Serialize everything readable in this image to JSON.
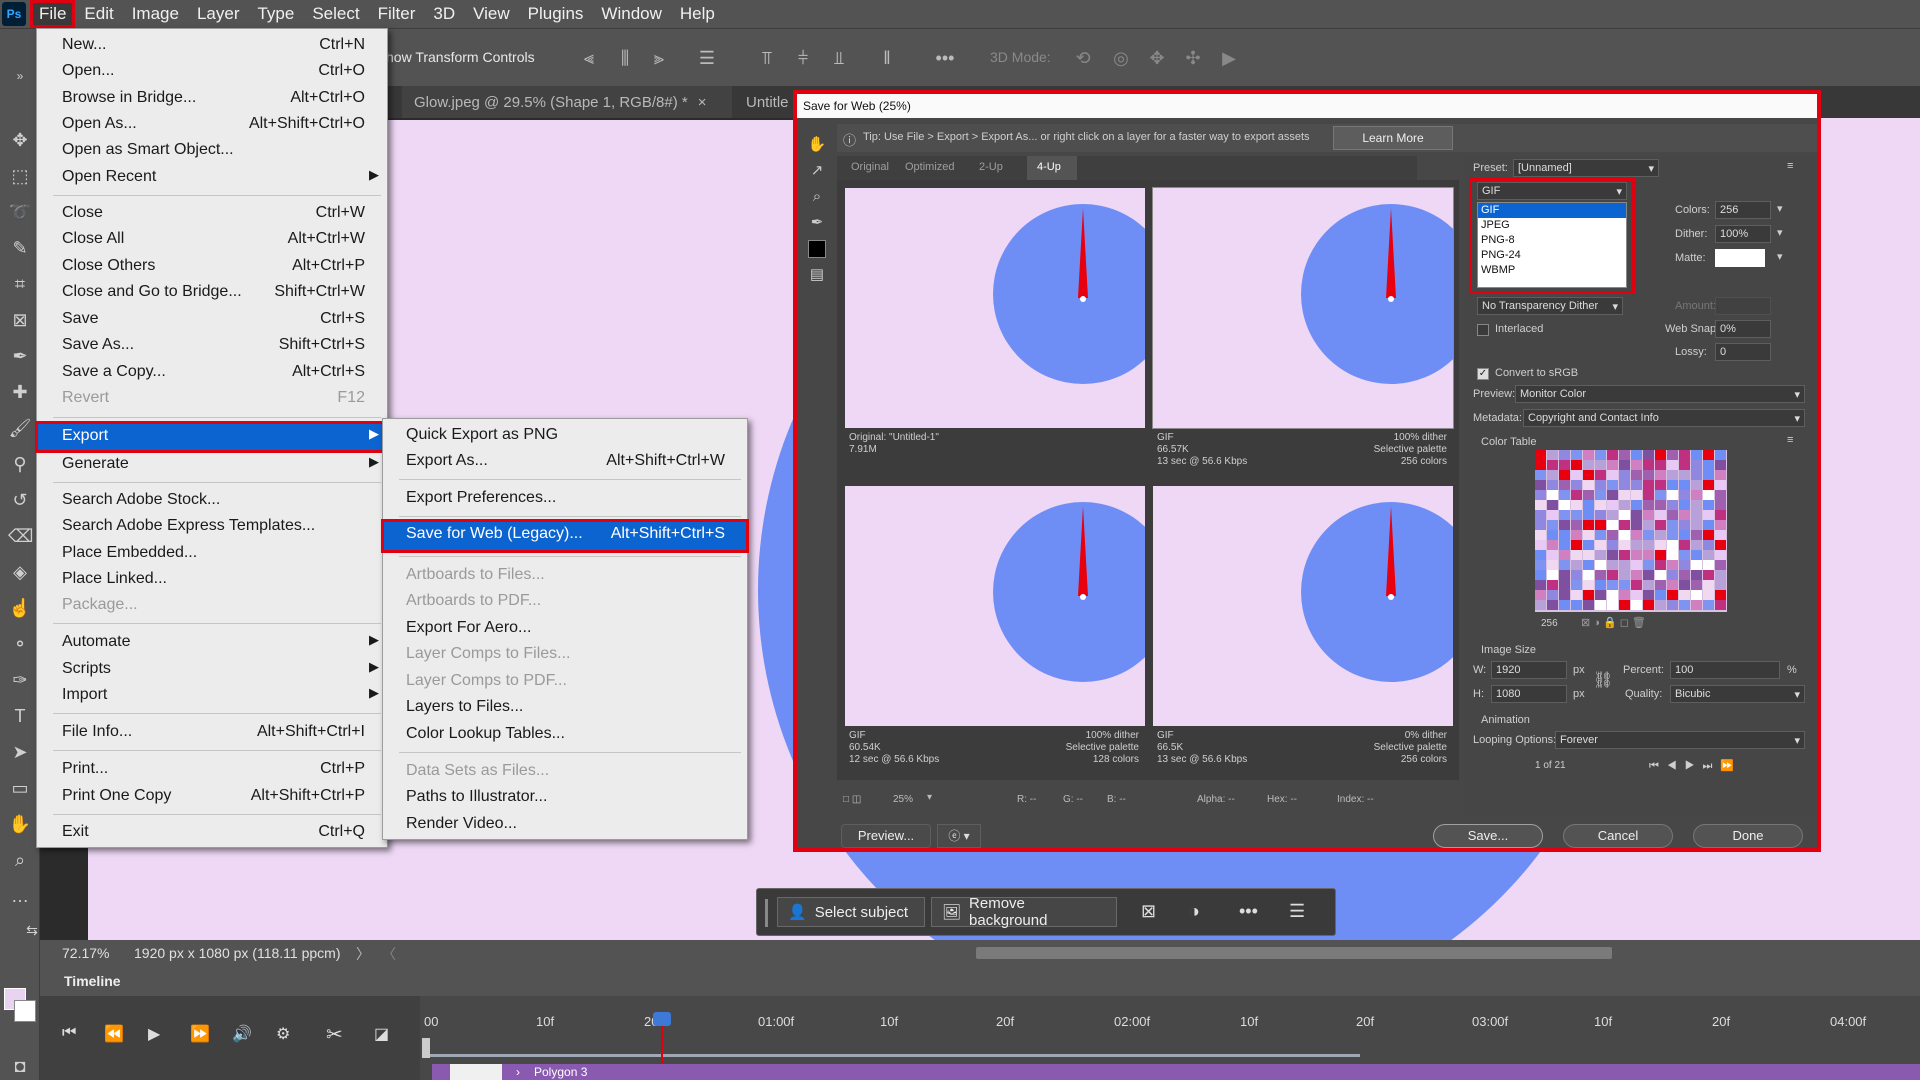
{
  "menubar": {
    "logo": "Ps",
    "items": [
      "File",
      "Edit",
      "Image",
      "Layer",
      "Type",
      "Select",
      "Filter",
      "3D",
      "View",
      "Plugins",
      "Window",
      "Help"
    ]
  },
  "options_bar": {
    "show_transform_controls": "how Transform Controls",
    "mode_3d": "3D Mode:"
  },
  "tabs": [
    {
      "label": "Glow.jpeg @ 29.5% (Shape 1, RGB/8#) *",
      "close": "×"
    },
    {
      "label": "Untitle"
    }
  ],
  "file_menu": {
    "items": [
      {
        "label": "New...",
        "shortcut": "Ctrl+N"
      },
      {
        "label": "Open...",
        "shortcut": "Ctrl+O"
      },
      {
        "label": "Browse in Bridge...",
        "shortcut": "Alt+Ctrl+O"
      },
      {
        "label": "Open As...",
        "shortcut": "Alt+Shift+Ctrl+O"
      },
      {
        "label": "Open as Smart Object...",
        "shortcut": ""
      },
      {
        "label": "Open Recent",
        "shortcut": ""
      },
      {
        "label": "Close",
        "shortcut": "Ctrl+W"
      },
      {
        "label": "Close All",
        "shortcut": "Alt+Ctrl+W"
      },
      {
        "label": "Close Others",
        "shortcut": "Alt+Ctrl+P"
      },
      {
        "label": "Close and Go to Bridge...",
        "shortcut": "Shift+Ctrl+W"
      },
      {
        "label": "Save",
        "shortcut": "Ctrl+S"
      },
      {
        "label": "Save As...",
        "shortcut": "Shift+Ctrl+S"
      },
      {
        "label": "Save a Copy...",
        "shortcut": "Alt+Ctrl+S"
      },
      {
        "label": "Revert",
        "shortcut": "F12"
      },
      {
        "label": "Export",
        "shortcut": ""
      },
      {
        "label": "Generate",
        "shortcut": ""
      },
      {
        "label": "Search Adobe Stock...",
        "shortcut": ""
      },
      {
        "label": "Search Adobe Express Templates...",
        "shortcut": ""
      },
      {
        "label": "Place Embedded...",
        "shortcut": ""
      },
      {
        "label": "Place Linked...",
        "shortcut": ""
      },
      {
        "label": "Package...",
        "shortcut": ""
      },
      {
        "label": "Automate",
        "shortcut": ""
      },
      {
        "label": "Scripts",
        "shortcut": ""
      },
      {
        "label": "Import",
        "shortcut": ""
      },
      {
        "label": "File Info...",
        "shortcut": "Alt+Shift+Ctrl+I"
      },
      {
        "label": "Print...",
        "shortcut": "Ctrl+P"
      },
      {
        "label": "Print One Copy",
        "shortcut": "Alt+Shift+Ctrl+P"
      },
      {
        "label": "Exit",
        "shortcut": "Ctrl+Q"
      }
    ]
  },
  "export_menu": {
    "items": [
      {
        "label": "Quick Export as PNG",
        "shortcut": ""
      },
      {
        "label": "Export As...",
        "shortcut": "Alt+Shift+Ctrl+W"
      },
      {
        "label": "Export Preferences...",
        "shortcut": ""
      },
      {
        "label": "Save for Web (Legacy)...",
        "shortcut": "Alt+Shift+Ctrl+S"
      },
      {
        "label": "Artboards to Files...",
        "shortcut": ""
      },
      {
        "label": "Artboards to PDF...",
        "shortcut": ""
      },
      {
        "label": "Export For Aero...",
        "shortcut": ""
      },
      {
        "label": "Layer Comps to Files...",
        "shortcut": ""
      },
      {
        "label": "Layer Comps to PDF...",
        "shortcut": ""
      },
      {
        "label": "Layers to Files...",
        "shortcut": ""
      },
      {
        "label": "Color Lookup Tables...",
        "shortcut": ""
      },
      {
        "label": "Data Sets as Files...",
        "shortcut": ""
      },
      {
        "label": "Paths to Illustrator...",
        "shortcut": ""
      },
      {
        "label": "Render Video...",
        "shortcut": ""
      }
    ]
  },
  "save_for_web": {
    "title": "Save for Web (25%)",
    "tip": "Tip: Use File > Export > Export As...  or right click on a layer for a faster way to export assets",
    "learn_more": "Learn More",
    "view_tabs": [
      "Original",
      "Optimized",
      "2-Up",
      "4-Up"
    ],
    "cells": [
      {
        "l1": "Original: \"Untitled-1\"",
        "l2": "7.91M",
        "l3": "",
        "r1": "",
        "r2": "",
        "r3": ""
      },
      {
        "l1": "GIF",
        "l2": "66.57K",
        "l3": "13 sec @ 56.6 Kbps",
        "r1": "100% dither",
        "r2": "Selective palette",
        "r3": "256 colors"
      },
      {
        "l1": "GIF",
        "l2": "60.54K",
        "l3": "12 sec @ 56.6 Kbps",
        "r1": "100% dither",
        "r2": "Selective palette",
        "r3": "128 colors"
      },
      {
        "l1": "GIF",
        "l2": "66.5K",
        "l3": "13 sec @ 56.6 Kbps",
        "r1": "0% dither",
        "r2": "Selective palette",
        "r3": "256 colors"
      }
    ],
    "zoom": "25%",
    "readouts": [
      "R: --",
      "G: --",
      "B: --",
      "Alpha: --",
      "Hex: --",
      "Index: --"
    ],
    "preview_btn": "Preview...",
    "preset_label": "Preset:",
    "preset_value": "[Unnamed]",
    "format_value": "GIF",
    "format_options": [
      "GIF",
      "JPEG",
      "PNG-8",
      "PNG-24",
      "WBMP"
    ],
    "colors_label": "Colors:",
    "colors_value": "256",
    "dither_label": "Dither:",
    "dither_value": "100%",
    "matte_label": "Matte:",
    "transparency_dither": "No Transparency Dither",
    "amount_label": "Amount:",
    "interlaced": "Interlaced",
    "web_snap_label": "Web Snap:",
    "web_snap_value": "0%",
    "lossy_label": "Lossy:",
    "lossy_value": "0",
    "convert_srgb": "Convert to sRGB",
    "preview_label": "Preview:",
    "preview_value": "Monitor Color",
    "metadata_label": "Metadata:",
    "metadata_value": "Copyright and Contact Info",
    "color_table": "Color Table",
    "color_count": "256",
    "image_size": "Image Size",
    "w_label": "W:",
    "w_value": "1920",
    "h_label": "H:",
    "h_value": "1080",
    "px": "px",
    "percent_label": "Percent:",
    "percent_value": "100",
    "percent_unit": "%",
    "quality_label": "Quality:",
    "quality_value": "Bicubic",
    "animation": "Animation",
    "looping_label": "Looping Options:",
    "looping_value": "Forever",
    "frame": "1 of 21",
    "save_btn": "Save...",
    "cancel_btn": "Cancel",
    "done_btn": "Done"
  },
  "taskbar": {
    "select_subject": "Select subject",
    "remove_background": "Remove background"
  },
  "status": {
    "zoom": "72.17%",
    "doc_info": "1920 px x 1080 px (118.11 ppcm)"
  },
  "timeline": {
    "title": "Timeline",
    "ticks": [
      "00",
      "10f",
      "20f",
      "01:00f",
      "10f",
      "20f",
      "02:00f",
      "10f",
      "20f",
      "03:00f",
      "10f",
      "20f",
      "04:00f"
    ],
    "layer": "Polygon 3"
  },
  "colors": {
    "canvas": "#efd8f6",
    "circle": "#6f8ef5",
    "needle": "#e8000e",
    "highlight": "#e0000f",
    "menu_select": "#0c64d1"
  }
}
